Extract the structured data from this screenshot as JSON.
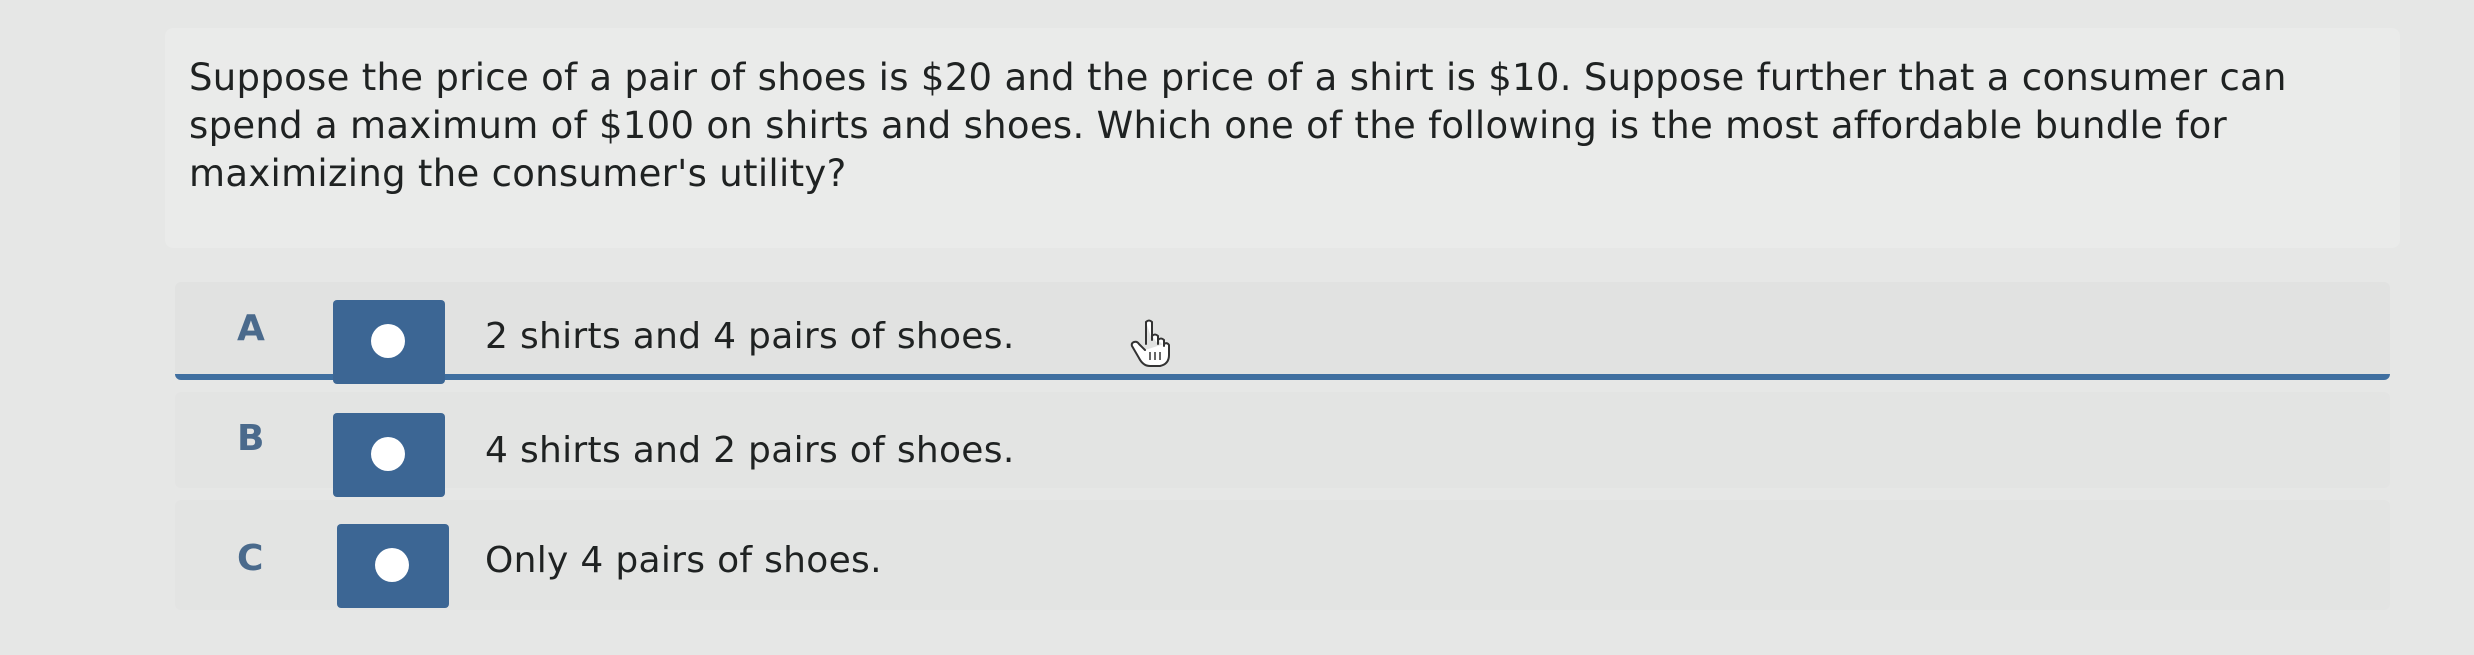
{
  "question": {
    "text": "Suppose the price of a pair of shoes is $20 and the price of a shirt is $10. Suppose further that a consumer can spend a maximum of $100 on shirts and shoes. Which one of the following is the most affordable bundle for maximizing the consumer's utility?"
  },
  "choices": [
    {
      "letter": "A",
      "text": "2 shirts and 4 pairs of shoes.",
      "selected": true
    },
    {
      "letter": "B",
      "text": "4 shirts and 2 pairs of shoes.",
      "selected": false
    },
    {
      "letter": "C",
      "text": "Only 4 pairs of shoes.",
      "selected": false
    }
  ],
  "colors": {
    "accent": "#3c6694",
    "letter": "#4a6a8c",
    "text": "#1f2222",
    "background": "#e6e7e6"
  },
  "icons": {
    "cursor": "pointer-hand-icon",
    "radio": "radio-button-icon"
  }
}
